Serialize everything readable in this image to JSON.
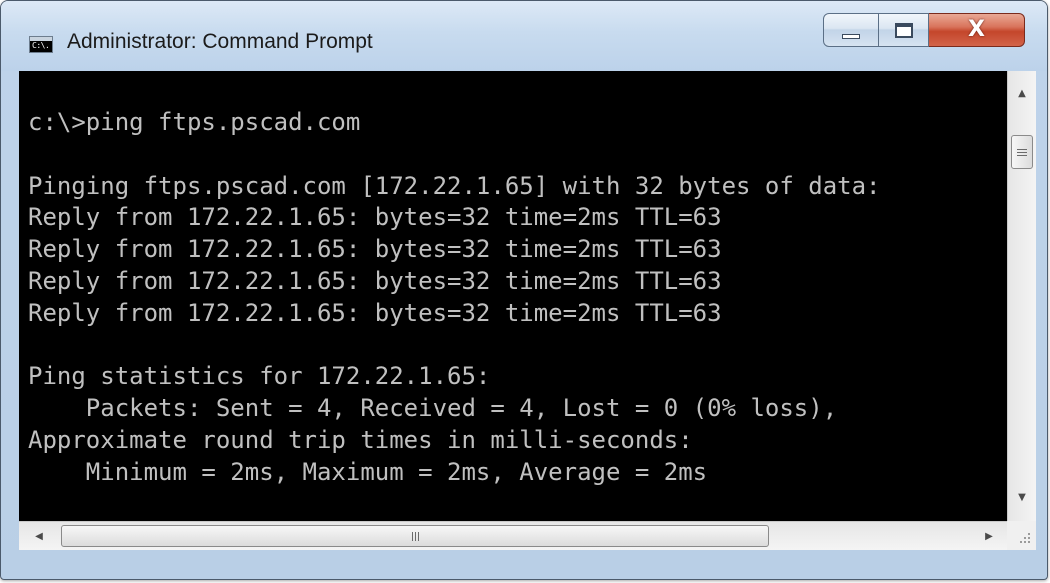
{
  "window": {
    "title": "Administrator: Command Prompt",
    "icon": "cmd-icon",
    "icon_text": "C:\\."
  },
  "controls": {
    "minimize_icon": "minimize-icon",
    "maximize_icon": "maximize-icon",
    "close_icon": "close-icon",
    "close_glyph": "X"
  },
  "console": {
    "lines": [
      "c:\\>ping ftps.pscad.com",
      "",
      "Pinging ftps.pscad.com [172.22.1.65] with 32 bytes of data:",
      "Reply from 172.22.1.65: bytes=32 time=2ms TTL=63",
      "Reply from 172.22.1.65: bytes=32 time=2ms TTL=63",
      "Reply from 172.22.1.65: bytes=32 time=2ms TTL=63",
      "Reply from 172.22.1.65: bytes=32 time=2ms TTL=63",
      "",
      "Ping statistics for 172.22.1.65:",
      "    Packets: Sent = 4, Received = 4, Lost = 0 (0% loss),",
      "Approximate round trip times in milli-seconds:",
      "    Minimum = 2ms, Maximum = 2ms, Average = 2ms"
    ],
    "background": "#000000",
    "foreground": "#c0c0c0"
  },
  "scrollbars": {
    "up_arrow": "▲",
    "down_arrow": "▼",
    "left_arrow": "◀",
    "right_arrow": "▶"
  }
}
